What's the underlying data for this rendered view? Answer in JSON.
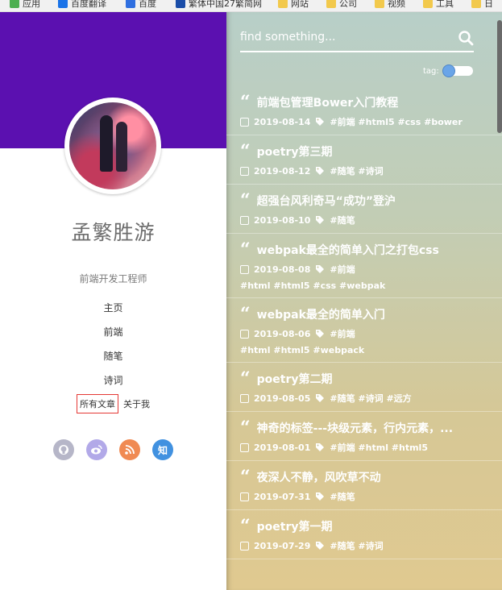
{
  "bookmarks": [
    {
      "label": "应用",
      "color": "#4caf50"
    },
    {
      "label": "百度翻译",
      "color": "#1a73e8"
    },
    {
      "label": "百度",
      "color": "#2f6fe0"
    },
    {
      "label": "繁体中国27繁简网",
      "color": "#1a4da8"
    },
    {
      "label": "网站",
      "color": "#f2c94c"
    },
    {
      "label": "公司",
      "color": "#f2c94c"
    },
    {
      "label": "视频",
      "color": "#f2c94c"
    },
    {
      "label": "工具",
      "color": "#f2c94c"
    },
    {
      "label": "日",
      "color": "#f2c94c"
    }
  ],
  "profile": {
    "name": "孟繁胜游",
    "subtitle": "前端开发工程师",
    "banner_color": "#5b10b0"
  },
  "nav": {
    "items": [
      "主页",
      "前端",
      "随笔",
      "诗词"
    ],
    "all_articles": "所有文章",
    "about": "关于我"
  },
  "socials": [
    {
      "name": "github",
      "glyph": ""
    },
    {
      "name": "weibo",
      "glyph": ""
    },
    {
      "name": "rss",
      "glyph": ""
    },
    {
      "name": "zhihu",
      "glyph": "知"
    }
  ],
  "search": {
    "placeholder": "find something..."
  },
  "tag_toggle": {
    "label": "tag:"
  },
  "posts": [
    {
      "title": "前端包管理Bower入门教程",
      "date": "2019-08-14",
      "tags": "#前端 #html5 #css #bower",
      "extra": ""
    },
    {
      "title": "poetry第三期",
      "date": "2019-08-12",
      "tags": "#随笔 #诗词",
      "extra": ""
    },
    {
      "title": "超强台风利奇马“成功”登沪",
      "date": "2019-08-10",
      "tags": "#随笔",
      "extra": ""
    },
    {
      "title": "webpak最全的简单入门之打包css",
      "date": "2019-08-08",
      "tags": "#前端",
      "extra": "#html #html5 #css #webpak"
    },
    {
      "title": "webpak最全的简单入门",
      "date": "2019-08-06",
      "tags": "#前端",
      "extra": "#html #html5 #webpack"
    },
    {
      "title": "poetry第二期",
      "date": "2019-08-05",
      "tags": "#随笔 #诗词 #远方",
      "extra": ""
    },
    {
      "title": "神奇的标签---块级元素，行内元素，...",
      "date": "2019-08-01",
      "tags": "#前端 #html #html5",
      "extra": ""
    },
    {
      "title": "夜深人不静，风吹草不动",
      "date": "2019-07-31",
      "tags": "#随笔",
      "extra": ""
    },
    {
      "title": "poetry第一期",
      "date": "2019-07-29",
      "tags": "#随笔 #诗词",
      "extra": ""
    }
  ]
}
